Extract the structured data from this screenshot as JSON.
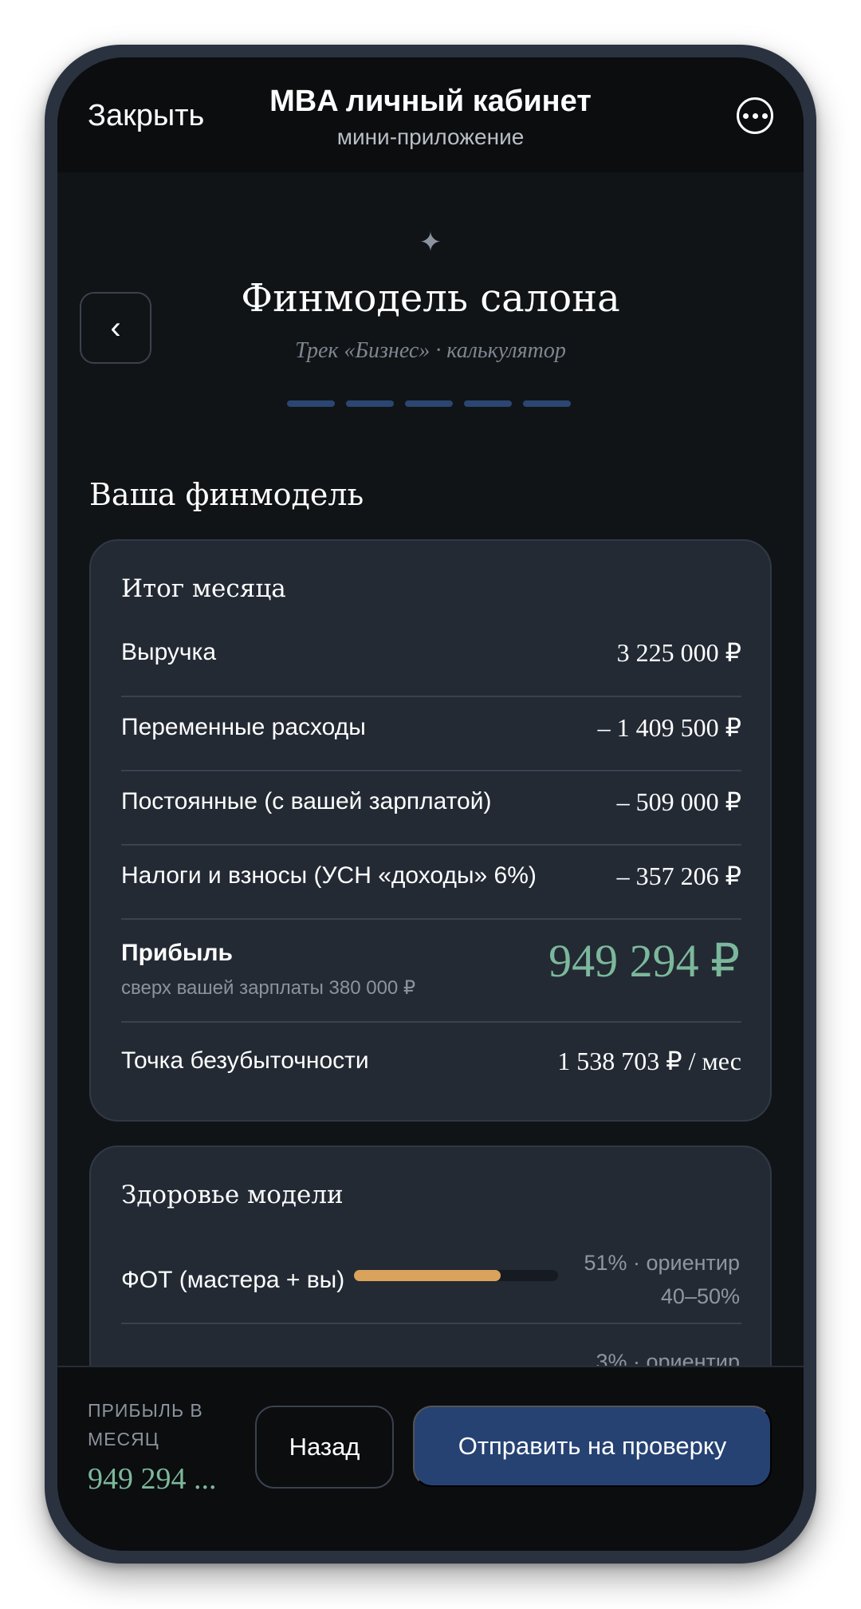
{
  "topbar": {
    "close_label": "Закрыть",
    "title": "MBA личный кабинет",
    "subtitle": "мини-приложение",
    "more_icon": "more-horizontal-icon"
  },
  "header": {
    "sparkle": "✦",
    "back_icon": "‹",
    "title": "Финмодель салона",
    "subtitle": "Трек «Бизнес» · калькулятор",
    "steps_total": 5
  },
  "section_title": "Ваша финмодель",
  "month": {
    "title": "Итог месяца",
    "rows": [
      {
        "label": "Выручка",
        "value": "3 225 000 ₽"
      },
      {
        "label": "Переменные расходы",
        "value": "– 1 409 500 ₽"
      },
      {
        "label": "Постоянные (с вашей зарплатой)",
        "value": "– 509 000 ₽"
      },
      {
        "label": "Налоги и взносы (УСН «доходы» 6%)",
        "value": "– 357 206 ₽"
      }
    ],
    "profit_label": "Прибыль",
    "profit_note": "сверх вашей зарплаты 380 000 ₽",
    "profit_value": "949 294 ₽",
    "breakeven_label": "Точка безубыточности",
    "breakeven_value": "1 538 703 ₽ / мес"
  },
  "health": {
    "title": "Здоровье модели",
    "items": [
      {
        "label": "ФОТ (мастера + вы)",
        "meta": "51% · ориентир 40–50%",
        "fill": 0.72
      },
      {
        "label": "",
        "meta": "3% · ориентир"
      }
    ],
    "accent": "#d9a35b"
  },
  "bottom": {
    "caption": "ПРИБЫЛЬ В МЕСЯЦ",
    "value": "949 294 ...",
    "back_label": "Назад",
    "submit_label": "Отправить на проверку"
  },
  "colors": {
    "background": "#111417",
    "card": "#232a34",
    "profit": "#7cb89b",
    "primary_button": "#254273",
    "step_active": "#2b4672"
  }
}
